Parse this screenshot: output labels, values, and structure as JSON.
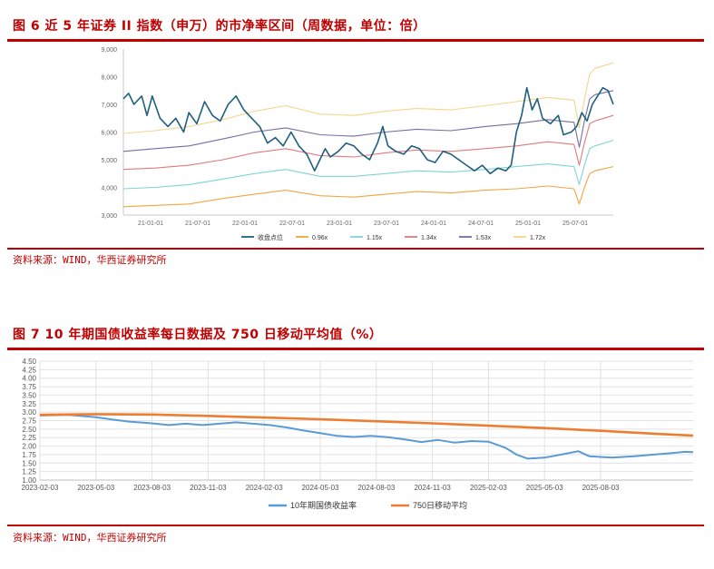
{
  "figures": [
    {
      "title": "图 6   近 5 年证券 II 指数（申万）的市净率区间（周数据，单位：倍）",
      "source": "资料来源：WIND，华西证券研究所",
      "chart_data": {
        "type": "line",
        "y_ticks": [
          "3,000",
          "4,000",
          "5,000",
          "6,000",
          "7,000",
          "8,000",
          "9,000"
        ],
        "ylim": [
          3000,
          9000
        ],
        "x_ticks": [
          "21-01-01",
          "21-07-01",
          "22-01-01",
          "22-07-01",
          "23-01-01",
          "23-07-01",
          "24-01-01",
          "24-07-01",
          "25-01-01",
          "25-07-01"
        ],
        "grid": false,
        "legend_position": "bottom",
        "series": [
          {
            "name": "收盘点位",
            "color": "#1f5f7f",
            "style": "thick",
            "points": [
              [
                0,
                7200
              ],
              [
                2,
                7400
              ],
              [
                4,
                7000
              ],
              [
                7,
                7300
              ],
              [
                9,
                6600
              ],
              [
                11,
                7300
              ],
              [
                14,
                6500
              ],
              [
                17,
                6200
              ],
              [
                20,
                6500
              ],
              [
                23,
                6000
              ],
              [
                25,
                6700
              ],
              [
                28,
                6300
              ],
              [
                31,
                7100
              ],
              [
                34,
                6600
              ],
              [
                37,
                6400
              ],
              [
                40,
                7000
              ],
              [
                43,
                7300
              ],
              [
                46,
                6800
              ],
              [
                49,
                6500
              ],
              [
                52,
                6200
              ],
              [
                55,
                5600
              ],
              [
                58,
                5800
              ],
              [
                61,
                5500
              ],
              [
                64,
                6000
              ],
              [
                67,
                5500
              ],
              [
                70,
                5200
              ],
              [
                73,
                4600
              ],
              [
                75,
                5000
              ],
              [
                77,
                5400
              ],
              [
                79,
                5100
              ],
              [
                82,
                5300
              ],
              [
                85,
                5600
              ],
              [
                88,
                5500
              ],
              [
                91,
                5200
              ],
              [
                94,
                5000
              ],
              [
                97,
                5600
              ],
              [
                99,
                6200
              ],
              [
                101,
                5500
              ],
              [
                104,
                5300
              ],
              [
                107,
                5200
              ],
              [
                110,
                5500
              ],
              [
                113,
                5400
              ],
              [
                116,
                5000
              ],
              [
                119,
                4900
              ],
              [
                122,
                5300
              ],
              [
                125,
                5200
              ],
              [
                128,
                5000
              ],
              [
                131,
                4800
              ],
              [
                134,
                4600
              ],
              [
                137,
                4800
              ],
              [
                140,
                4500
              ],
              [
                143,
                4700
              ],
              [
                146,
                4600
              ],
              [
                148,
                4800
              ],
              [
                150,
                6000
              ],
              [
                152,
                6600
              ],
              [
                154,
                7600
              ],
              [
                156,
                6800
              ],
              [
                158,
                7200
              ],
              [
                160,
                6500
              ],
              [
                163,
                6300
              ],
              [
                166,
                6600
              ],
              [
                168,
                5900
              ],
              [
                171,
                6000
              ],
              [
                173,
                6200
              ],
              [
                175,
                6700
              ],
              [
                177,
                6400
              ],
              [
                179,
                7000
              ],
              [
                181,
                7300
              ],
              [
                183,
                7600
              ],
              [
                185,
                7500
              ],
              [
                187,
                7000
              ]
            ]
          },
          {
            "name": "0.96x",
            "color": "#f2a541",
            "points": [
              [
                0,
                3300
              ],
              [
                12,
                3350
              ],
              [
                25,
                3400
              ],
              [
                38,
                3600
              ],
              [
                50,
                3750
              ],
              [
                62,
                3900
              ],
              [
                75,
                3700
              ],
              [
                88,
                3650
              ],
              [
                100,
                3750
              ],
              [
                112,
                3850
              ],
              [
                125,
                3800
              ],
              [
                138,
                3900
              ],
              [
                150,
                3950
              ],
              [
                162,
                4050
              ],
              [
                172,
                3950
              ],
              [
                174,
                3400
              ],
              [
                176,
                4000
              ],
              [
                178,
                4500
              ],
              [
                180,
                4600
              ],
              [
                187,
                4750
              ]
            ]
          },
          {
            "name": "1.15x",
            "color": "#7fd3d8",
            "points": [
              [
                0,
                3950
              ],
              [
                12,
                4000
              ],
              [
                25,
                4100
              ],
              [
                38,
                4300
              ],
              [
                50,
                4500
              ],
              [
                62,
                4650
              ],
              [
                75,
                4400
              ],
              [
                88,
                4400
              ],
              [
                100,
                4500
              ],
              [
                112,
                4600
              ],
              [
                125,
                4550
              ],
              [
                138,
                4650
              ],
              [
                150,
                4750
              ],
              [
                162,
                4850
              ],
              [
                172,
                4750
              ],
              [
                174,
                4100
              ],
              [
                176,
                4800
              ],
              [
                178,
                5400
              ],
              [
                180,
                5500
              ],
              [
                187,
                5700
              ]
            ]
          },
          {
            "name": "1.34x",
            "color": "#e07b7b",
            "points": [
              [
                0,
                4650
              ],
              [
                12,
                4700
              ],
              [
                25,
                4800
              ],
              [
                38,
                5000
              ],
              [
                50,
                5250
              ],
              [
                62,
                5400
              ],
              [
                75,
                5150
              ],
              [
                88,
                5100
              ],
              [
                100,
                5250
              ],
              [
                112,
                5350
              ],
              [
                125,
                5300
              ],
              [
                138,
                5400
              ],
              [
                150,
                5500
              ],
              [
                162,
                5650
              ],
              [
                172,
                5550
              ],
              [
                174,
                4800
              ],
              [
                176,
                5600
              ],
              [
                178,
                6300
              ],
              [
                180,
                6400
              ],
              [
                187,
                6600
              ]
            ]
          },
          {
            "name": "1.53x",
            "color": "#7a6aa6",
            "points": [
              [
                0,
                5300
              ],
              [
                12,
                5400
              ],
              [
                25,
                5500
              ],
              [
                38,
                5750
              ],
              [
                50,
                6000
              ],
              [
                62,
                6150
              ],
              [
                75,
                5900
              ],
              [
                88,
                5850
              ],
              [
                100,
                6000
              ],
              [
                112,
                6100
              ],
              [
                125,
                6050
              ],
              [
                138,
                6200
              ],
              [
                150,
                6300
              ],
              [
                162,
                6450
              ],
              [
                172,
                6350
              ],
              [
                174,
                5450
              ],
              [
                176,
                6400
              ],
              [
                178,
                7200
              ],
              [
                180,
                7350
              ],
              [
                187,
                7500
              ]
            ]
          },
          {
            "name": "1.72x",
            "color": "#f5d58a",
            "points": [
              [
                0,
                5950
              ],
              [
                12,
                6050
              ],
              [
                25,
                6200
              ],
              [
                38,
                6450
              ],
              [
                50,
                6750
              ],
              [
                62,
                6950
              ],
              [
                75,
                6650
              ],
              [
                88,
                6600
              ],
              [
                100,
                6750
              ],
              [
                112,
                6850
              ],
              [
                125,
                6800
              ],
              [
                138,
                6950
              ],
              [
                150,
                7100
              ],
              [
                162,
                7250
              ],
              [
                172,
                7150
              ],
              [
                174,
                6150
              ],
              [
                176,
                7200
              ],
              [
                178,
                8100
              ],
              [
                180,
                8300
              ],
              [
                187,
                8500
              ]
            ]
          }
        ]
      }
    },
    {
      "title": "图 7   10 年期国债收益率每日数据及 750 日移动平均值（%）",
      "source": "资料来源：WIND，华西证券研究所",
      "chart_data": {
        "type": "line",
        "y_ticks": [
          "1.00",
          "1.25",
          "1.50",
          "1.75",
          "2.00",
          "2.25",
          "2.50",
          "2.75",
          "3.00",
          "3.25",
          "3.50",
          "3.75",
          "4.00",
          "4.25",
          "4.50"
        ],
        "ylim": [
          1.0,
          4.5
        ],
        "x_ticks": [
          "2023-02-03",
          "2023-05-03",
          "2023-08-03",
          "2023-11-03",
          "2024-02-03",
          "2024-05-03",
          "2024-08-03",
          "2024-11-03",
          "2025-02-03",
          "2025-05-03",
          "2025-08-03"
        ],
        "grid": true,
        "legend_position": "bottom",
        "series": [
          {
            "name": "10年期国债收益率",
            "color": "#5b9bd5",
            "points": [
              [
                0,
                2.9
              ],
              [
                0.5,
                2.92
              ],
              [
                1,
                2.85
              ],
              [
                1.3,
                2.78
              ],
              [
                1.6,
                2.72
              ],
              [
                2,
                2.67
              ],
              [
                2.3,
                2.62
              ],
              [
                2.6,
                2.66
              ],
              [
                2.9,
                2.62
              ],
              [
                3.2,
                2.66
              ],
              [
                3.5,
                2.7
              ],
              [
                3.8,
                2.66
              ],
              [
                4.1,
                2.62
              ],
              [
                4.4,
                2.55
              ],
              [
                4.7,
                2.46
              ],
              [
                5,
                2.38
              ],
              [
                5.3,
                2.3
              ],
              [
                5.6,
                2.27
              ],
              [
                5.9,
                2.3
              ],
              [
                6.2,
                2.26
              ],
              [
                6.5,
                2.2
              ],
              [
                6.8,
                2.12
              ],
              [
                7.1,
                2.18
              ],
              [
                7.4,
                2.1
              ],
              [
                7.7,
                2.15
              ],
              [
                8,
                2.13
              ],
              [
                8.3,
                1.95
              ],
              [
                8.5,
                1.75
              ],
              [
                8.7,
                1.63
              ],
              [
                9,
                1.66
              ],
              [
                9.3,
                1.75
              ],
              [
                9.6,
                1.85
              ],
              [
                9.8,
                1.7
              ],
              [
                10.2,
                1.66
              ],
              [
                10.6,
                1.7
              ],
              [
                11,
                1.76
              ],
              [
                11.3,
                1.8
              ],
              [
                11.5,
                1.83
              ],
              [
                11.65,
                1.82
              ]
            ]
          },
          {
            "name": "750日移动平均",
            "color": "#ed7d31",
            "points": [
              [
                0,
                2.92
              ],
              [
                1,
                2.94
              ],
              [
                2,
                2.93
              ],
              [
                3,
                2.89
              ],
              [
                4,
                2.84
              ],
              [
                5,
                2.79
              ],
              [
                6,
                2.73
              ],
              [
                7,
                2.67
              ],
              [
                8,
                2.6
              ],
              [
                9,
                2.53
              ],
              [
                10,
                2.45
              ],
              [
                11,
                2.36
              ],
              [
                11.65,
                2.31
              ]
            ]
          }
        ]
      }
    }
  ]
}
